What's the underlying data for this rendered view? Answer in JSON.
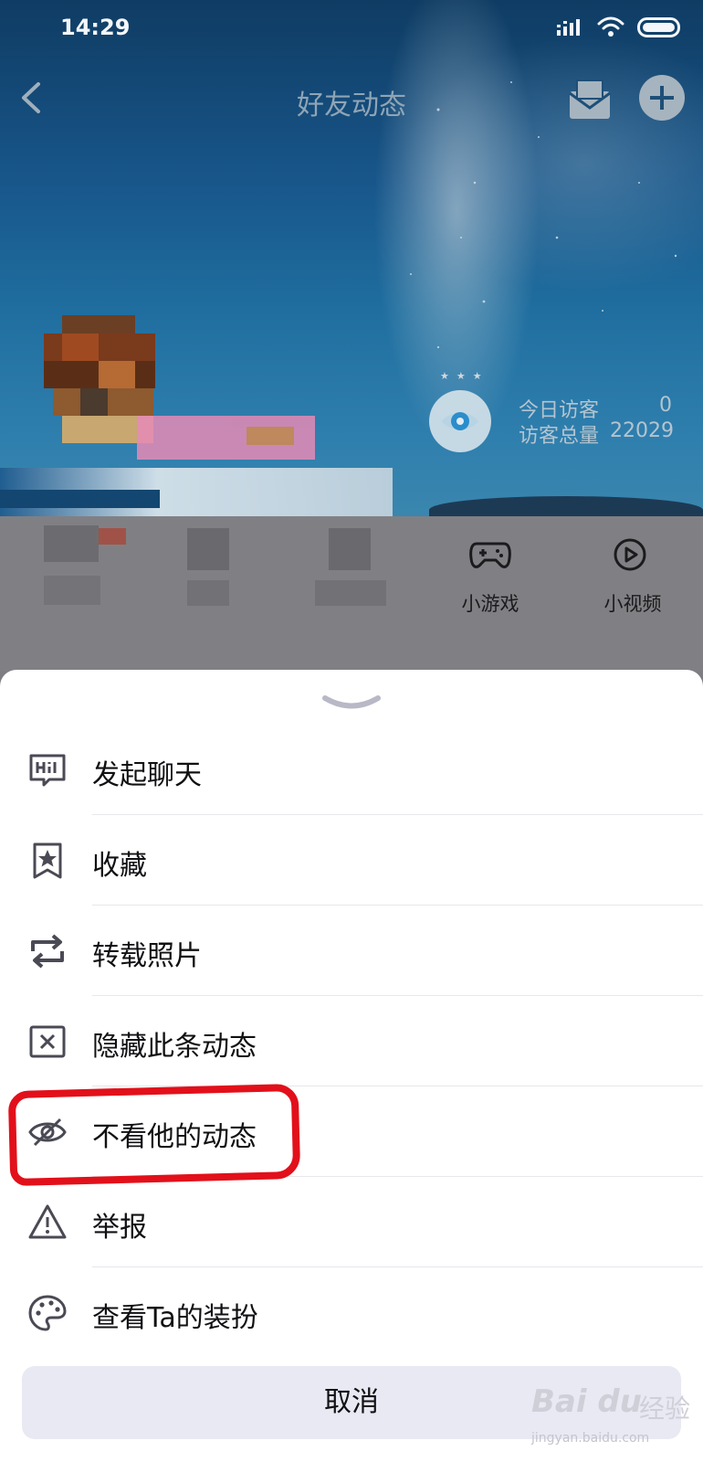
{
  "status_bar": {
    "time": "14:29"
  },
  "nav": {
    "title": "好友动态"
  },
  "visitor": {
    "today_label": "今日访客",
    "today_value": "0",
    "total_label": "访客总量",
    "total_value": "22029"
  },
  "quick_entries": [
    {
      "label": "小游戏",
      "icon": "gamepad-icon"
    },
    {
      "label": "小视频",
      "icon": "video-play-icon"
    }
  ],
  "sheet": {
    "items": [
      {
        "label": "发起聊天",
        "icon": "chat-hi-icon"
      },
      {
        "label": "收藏",
        "icon": "bookmark-star-icon"
      },
      {
        "label": "转载照片",
        "icon": "repost-icon"
      },
      {
        "label": "隐藏此条动态",
        "icon": "hide-post-icon"
      },
      {
        "label": "不看他的动态",
        "icon": "eye-off-icon"
      },
      {
        "label": "举报",
        "icon": "warning-icon"
      },
      {
        "label": "查看Ta的装扮",
        "icon": "palette-icon"
      }
    ],
    "cancel_label": "取消"
  },
  "watermark": {
    "logo": "Bai du",
    "text": "经验",
    "url": "jingyan.baidu.com"
  },
  "colors": {
    "annotation_red": "#e2101a",
    "sheet_bg": "#ffffff",
    "cancel_bg": "#e9e9f4"
  }
}
